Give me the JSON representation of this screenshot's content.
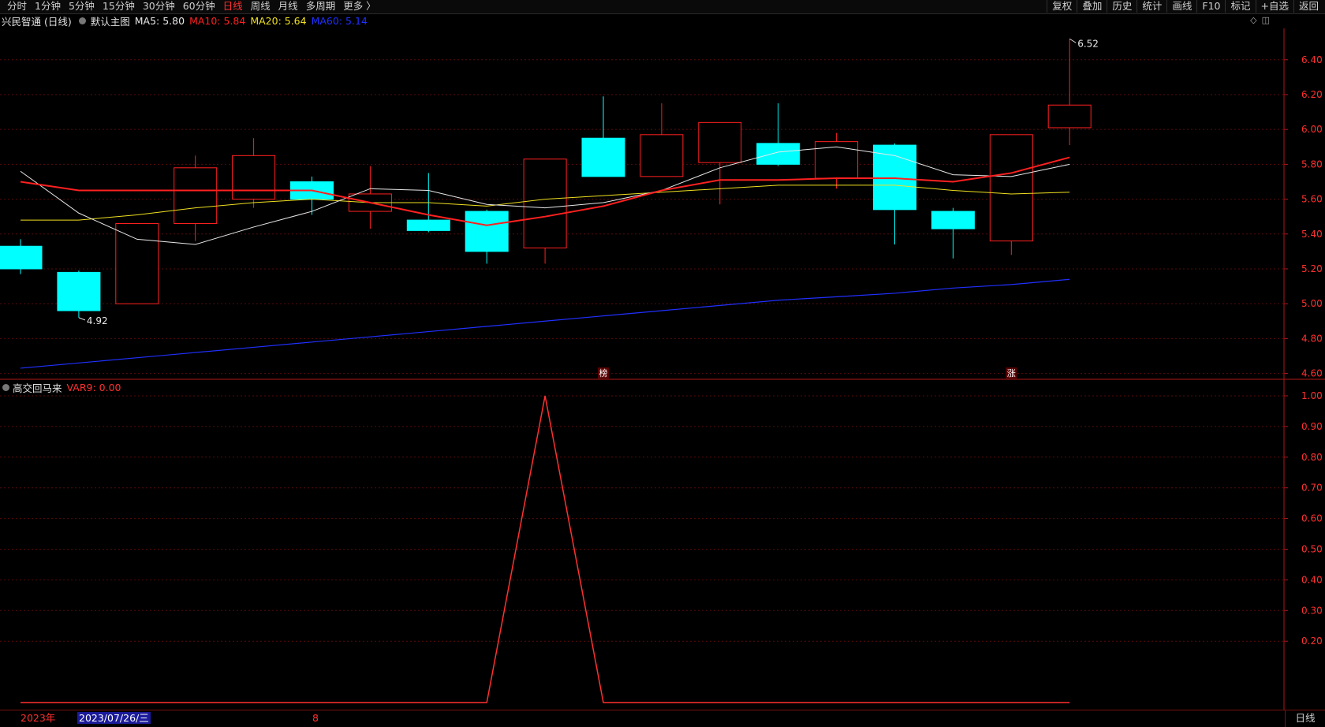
{
  "tabs": [
    {
      "label": "分时",
      "active": false
    },
    {
      "label": "1分钟",
      "active": false
    },
    {
      "label": "5分钟",
      "active": false
    },
    {
      "label": "15分钟",
      "active": false
    },
    {
      "label": "30分钟",
      "active": false
    },
    {
      "label": "60分钟",
      "active": false
    },
    {
      "label": "日线",
      "active": true
    },
    {
      "label": "周线",
      "active": false
    },
    {
      "label": "月线",
      "active": false
    },
    {
      "label": "多周期",
      "active": false
    },
    {
      "label": "更多 〉",
      "active": false
    }
  ],
  "tools": [
    "复权",
    "叠加",
    "历史",
    "统计",
    "画线",
    "F10",
    "标记",
    "+自选",
    "返回"
  ],
  "header": {
    "stock": "兴民智通 (日线)",
    "template": "默认主图",
    "ma5": {
      "label": "MA5: 5.80",
      "color": "#e8e8e8"
    },
    "ma10": {
      "label": "MA10: 5.84",
      "color": "#ff2020"
    },
    "ma20": {
      "label": "MA20: 5.64",
      "color": "#f0e020"
    },
    "ma60": {
      "label": "MA60: 5.14",
      "color": "#2030ff"
    }
  },
  "indicator": {
    "name": "高交回马来",
    "var_label": "VAR9: 0.00",
    "var_color": "#ff3030"
  },
  "footer": {
    "year": "2023年",
    "date": "2023/07/26/三",
    "marker": "8",
    "period": "日线"
  },
  "colors": {
    "up": "#ff2020",
    "down": "#00ffff",
    "grid": "#5a0a0a",
    "axis": "#b01818"
  },
  "chart_data": [
    {
      "type": "candlestick",
      "price_axis": {
        "ticks": [
          "6.40",
          "6.20",
          "6.00",
          "5.80",
          "5.60",
          "5.40",
          "5.20",
          "5.00",
          "4.80",
          "4.60"
        ],
        "ylim": [
          4.58,
          6.58
        ]
      },
      "candles": [
        {
          "o": 5.33,
          "h": 5.37,
          "l": 5.17,
          "c": 5.2
        },
        {
          "o": 5.18,
          "h": 5.19,
          "l": 4.92,
          "c": 4.96
        },
        {
          "o": 5.0,
          "h": 5.46,
          "l": 5.0,
          "c": 5.46
        },
        {
          "o": 5.46,
          "h": 5.85,
          "l": 5.36,
          "c": 5.78
        },
        {
          "o": 5.6,
          "h": 5.95,
          "l": 5.55,
          "c": 5.85
        },
        {
          "o": 5.7,
          "h": 5.73,
          "l": 5.51,
          "c": 5.6
        },
        {
          "o": 5.53,
          "h": 5.79,
          "l": 5.43,
          "c": 5.63
        },
        {
          "o": 5.48,
          "h": 5.75,
          "l": 5.41,
          "c": 5.42
        },
        {
          "o": 5.53,
          "h": 5.54,
          "l": 5.23,
          "c": 5.3
        },
        {
          "o": 5.32,
          "h": 5.83,
          "l": 5.23,
          "c": 5.83
        },
        {
          "o": 5.95,
          "h": 6.19,
          "l": 5.73,
          "c": 5.73
        },
        {
          "o": 5.73,
          "h": 6.15,
          "l": 5.73,
          "c": 5.97
        },
        {
          "o": 5.81,
          "h": 6.04,
          "l": 5.57,
          "c": 6.04
        },
        {
          "o": 5.92,
          "h": 6.15,
          "l": 5.79,
          "c": 5.8
        },
        {
          "o": 5.72,
          "h": 5.98,
          "l": 5.66,
          "c": 5.93
        },
        {
          "o": 5.91,
          "h": 5.92,
          "l": 5.34,
          "c": 5.54
        },
        {
          "o": 5.53,
          "h": 5.55,
          "l": 5.26,
          "c": 5.43
        },
        {
          "o": 5.36,
          "h": 5.97,
          "l": 5.28,
          "c": 5.97
        },
        {
          "o": 6.01,
          "h": 6.52,
          "l": 5.91,
          "c": 6.14
        }
      ],
      "ma5": [
        5.76,
        5.52,
        5.37,
        5.34,
        5.44,
        5.53,
        5.66,
        5.65,
        5.57,
        5.55,
        5.58,
        5.65,
        5.78,
        5.87,
        5.9,
        5.85,
        5.74,
        5.73,
        5.8
      ],
      "ma10": [
        5.7,
        5.65,
        5.65,
        5.65,
        5.65,
        5.65,
        5.58,
        5.51,
        5.45,
        5.5,
        5.56,
        5.65,
        5.71,
        5.71,
        5.72,
        5.72,
        5.7,
        5.75,
        5.84
      ],
      "ma20": [
        5.48,
        5.48,
        5.51,
        5.55,
        5.58,
        5.6,
        5.58,
        5.58,
        5.56,
        5.6,
        5.62,
        5.64,
        5.66,
        5.68,
        5.68,
        5.68,
        5.65,
        5.63,
        5.64
      ],
      "ma60": [
        4.63,
        4.66,
        4.69,
        4.72,
        4.75,
        4.78,
        4.81,
        4.84,
        4.87,
        4.9,
        4.93,
        4.96,
        4.99,
        5.02,
        5.04,
        5.06,
        5.09,
        5.11,
        5.14
      ],
      "high_label": "6.52",
      "low_label": "4.92",
      "markers": [
        {
          "index": 10,
          "text": "榜"
        },
        {
          "index": 17,
          "text": "涨"
        }
      ]
    },
    {
      "type": "line",
      "series": [
        {
          "name": "VAR9",
          "values": [
            0,
            0,
            0,
            0,
            0,
            0,
            0,
            0,
            0,
            1,
            0,
            0,
            0,
            0,
            0,
            0,
            0,
            0,
            0
          ]
        }
      ],
      "y_axis": {
        "ticks": [
          "1.00",
          "0.90",
          "0.80",
          "0.70",
          "0.60",
          "0.50",
          "0.40",
          "0.30",
          "0.20"
        ],
        "ylim": [
          0.0,
          1.0
        ]
      }
    }
  ]
}
